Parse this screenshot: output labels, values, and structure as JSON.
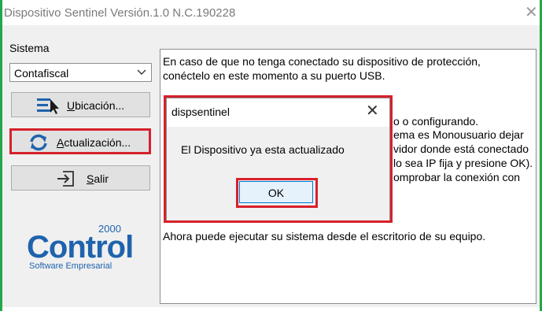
{
  "window": {
    "title": "Dispositivo Sentinel Versión.1.0 N.C.190228",
    "close_icon": "close-icon"
  },
  "left_panel": {
    "sistema_label": "Sistema",
    "combo_value": "Contafiscal",
    "buttons": {
      "ubicacion": "Ubicación...",
      "actualizacion": "Actualización...",
      "salir": "Salir"
    },
    "logo": {
      "main": "Control",
      "year": "2000",
      "subtitle": "Software Empresarial"
    }
  },
  "instructions": {
    "lines": [
      "En caso de que no tenga conectado su dispositivo de protección,",
      "conéctelo en este momento a su puerto USB.",
      "o o configurando.",
      "ema es Monousuario dejar",
      "vidor donde está conectado",
      "lo sea IP fija y presione OK).",
      "omprobar la conexión con",
      "Ahora puede ejecutar su sistema desde el escritorio de su equipo."
    ]
  },
  "dialog": {
    "title": "dispsentinel",
    "message": "El Dispositivo ya esta actualizado",
    "ok_label": "OK"
  },
  "colors": {
    "highlight": "#d6212b",
    "window_border": "#22a84a",
    "brand_blue": "#1f63ad"
  }
}
